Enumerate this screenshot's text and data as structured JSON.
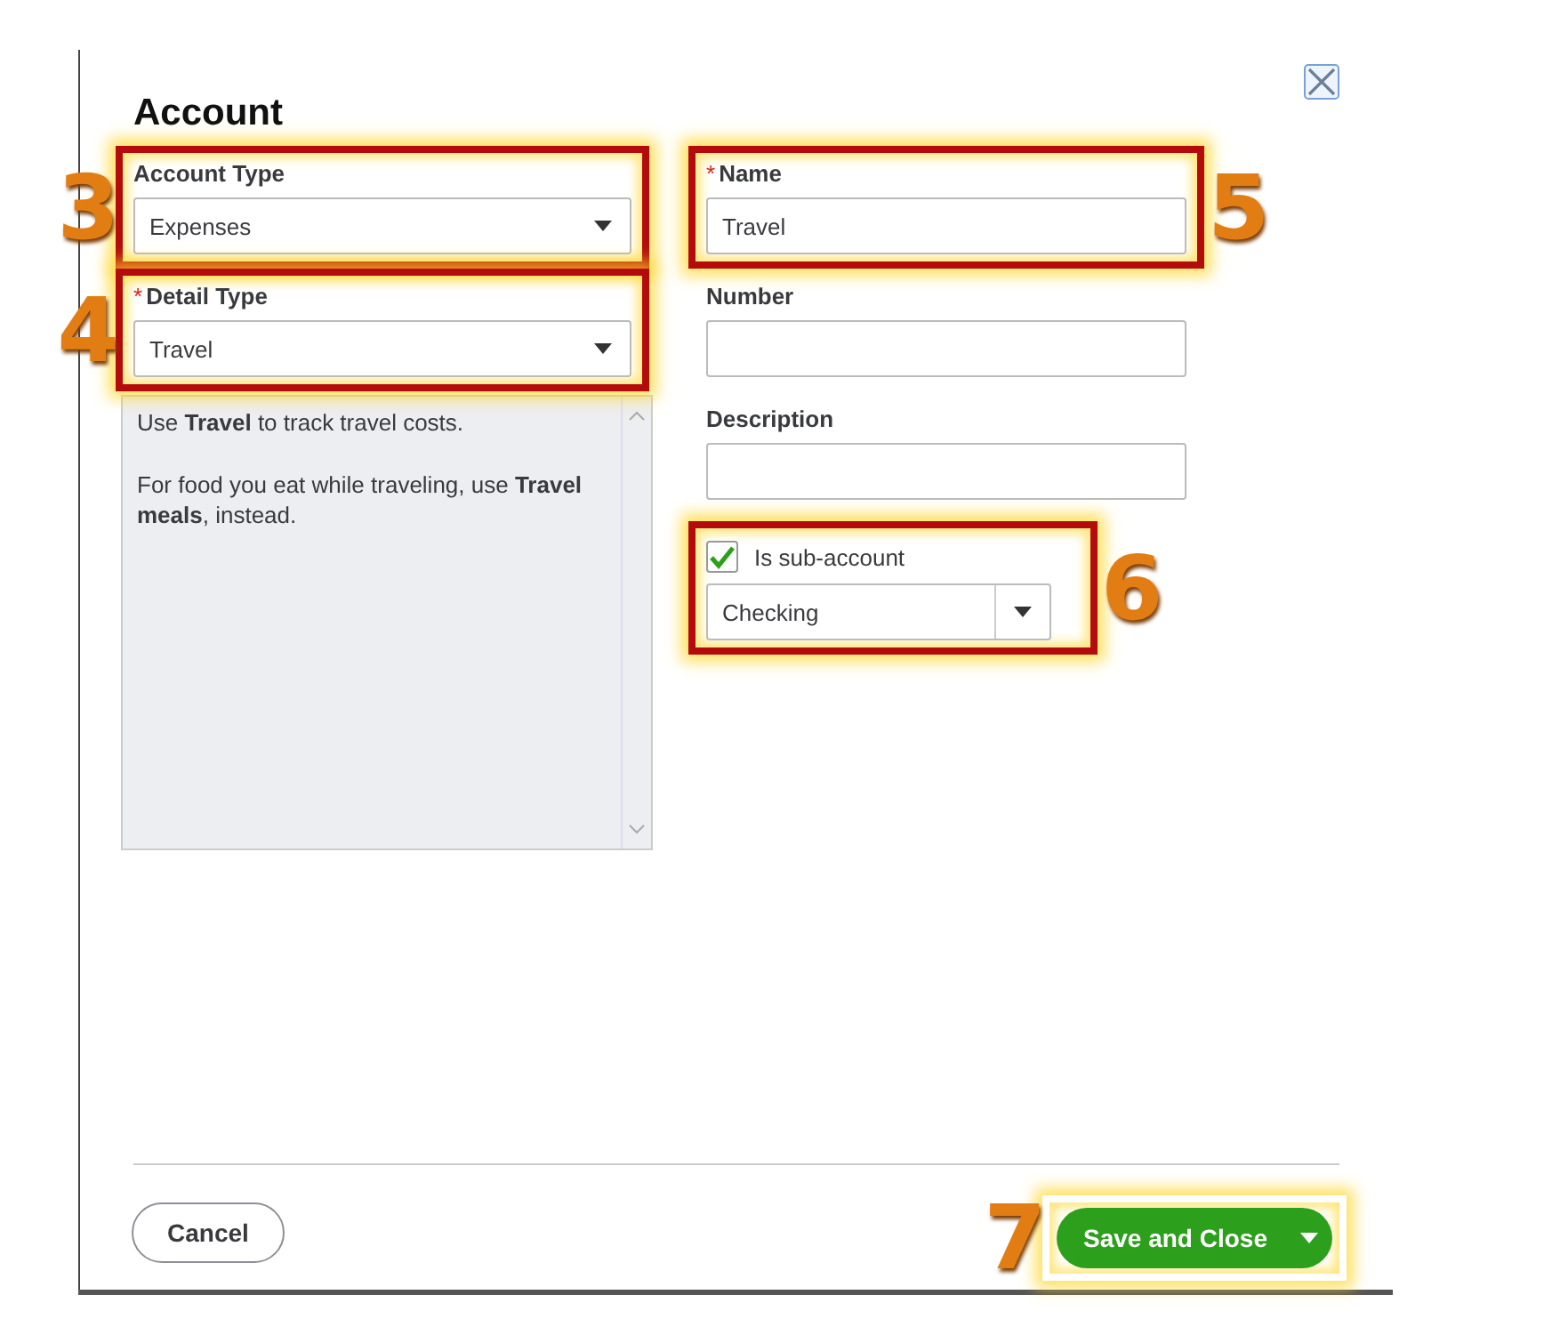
{
  "dialog": {
    "title": "Account"
  },
  "left_fields": [
    {
      "kind": "select",
      "label": "Account Type",
      "value": "Expenses",
      "callout": {
        "number": "3"
      }
    },
    {
      "kind": "select",
      "label": "Detail Type",
      "required_mark": "*",
      "value": "Travel",
      "callout": {
        "number": "4"
      }
    }
  ],
  "detail_help": [
    "Use **Travel** to track travel costs.",
    "For food you eat while traveling, use **Travel meals**, instead."
  ],
  "right_fields": [
    {
      "kind": "text",
      "label": "Name",
      "required_mark": "*",
      "value": "Travel",
      "callout": {
        "number": "5"
      }
    },
    {
      "kind": "text",
      "label": "Number"
    },
    {
      "kind": "text",
      "label": "Description"
    },
    {
      "kind": "subaccount",
      "label": "Is sub-account",
      "checked": true,
      "value": "Checking",
      "callout": {
        "number": "6"
      }
    }
  ],
  "footer": {
    "cancel": "Cancel",
    "save": {
      "label": "Save and Close",
      "callout": {
        "number": "7"
      }
    }
  }
}
